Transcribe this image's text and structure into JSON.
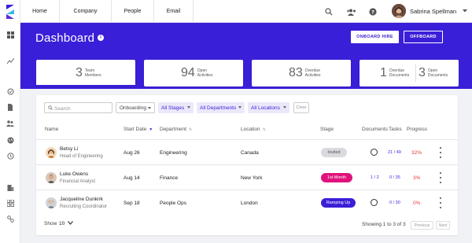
{
  "topnav": {
    "tabs": [
      {
        "label": "Home"
      },
      {
        "label": "Company"
      },
      {
        "label": "People"
      },
      {
        "label": "Email"
      }
    ],
    "user_name": "Sabrina Spellman"
  },
  "header": {
    "title": "Dashboard",
    "onboard_label": "ONBOARD HIRE",
    "offboard_label": "OFFBOARD",
    "accent_color": "#3a1fd8"
  },
  "stats": {
    "team": {
      "value": "3",
      "label": "Team Members"
    },
    "open_activities": {
      "value": "94",
      "label": "Open Activities"
    },
    "overdue_activities": {
      "value": "83",
      "label": "Overdue Activities"
    },
    "overdue_documents": {
      "value": "1",
      "label": "Overdue Documents"
    },
    "open_documents": {
      "value": "3",
      "label": "Open Documents"
    }
  },
  "filters": {
    "search_placeholder": "Search",
    "onboarding": "Onboarding",
    "stages": "All Stages",
    "departments": "All Departments",
    "locations": "All Locations",
    "clear": "Clear"
  },
  "table": {
    "headers": {
      "name": "Name",
      "start_date": "Start Date",
      "department": "Department",
      "location": "Location",
      "stage": "Stage",
      "documents": "Documents",
      "tasks": "Tasks",
      "progress": "Progress"
    },
    "rows": [
      {
        "name": "Betsy Li",
        "title": "Head of Engineering",
        "start": "Aug 26",
        "department": "Engineering",
        "location": "Canada",
        "stage": "Invited",
        "tasks": "21 / 49",
        "progress": "32%"
      },
      {
        "name": "Luke Owens",
        "title": "Financial Analyst",
        "start": "Aug 14",
        "department": "Finance",
        "location": "New York",
        "stage": "1st Month",
        "documents": "1 / 2",
        "tasks": "0 / 35",
        "progress": "3%"
      },
      {
        "name": "Jacqueline Dunkirk",
        "title": "Recruiting Coordinator",
        "start": "Sep 18",
        "department": "People Ops",
        "location": "London",
        "stage": "Ramping Up",
        "tasks": "0 / 30",
        "progress": "0%"
      }
    ],
    "stage_colors": {
      "Invited": "#d9d9de",
      "1st Month": "#e0127b",
      "Ramping Up": "#3a1fd8"
    }
  },
  "footer": {
    "show_label": "Show",
    "show_value": "10",
    "showing": "Showing 1 to 3 of 3",
    "previous": "Previous",
    "next": "Next"
  }
}
